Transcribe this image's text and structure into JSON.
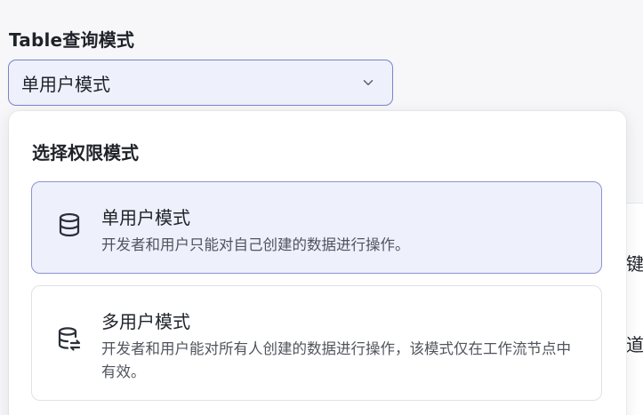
{
  "field": {
    "label": "Table查询模式",
    "selected_value": "单用户模式",
    "chevron_icon": "chevron-down-icon"
  },
  "background": {
    "char_1": "键",
    "char_2": "道"
  },
  "dropdown": {
    "title": "选择权限模式",
    "options": [
      {
        "icon": "database-icon",
        "title": "单用户模式",
        "description": "开发者和用户只能对自己创建的数据进行操作。",
        "selected": true
      },
      {
        "icon": "database-share-icon",
        "title": "多用户模式",
        "description": "开发者和用户能对所有人创建的数据进行操作，该模式仅在工作流节点中有效。",
        "selected": false
      }
    ]
  },
  "colors": {
    "accent_border": "#7b83c9",
    "selected_bg": "#eef0fb",
    "text_primary": "#1f2329",
    "text_secondary": "#50545c"
  }
}
